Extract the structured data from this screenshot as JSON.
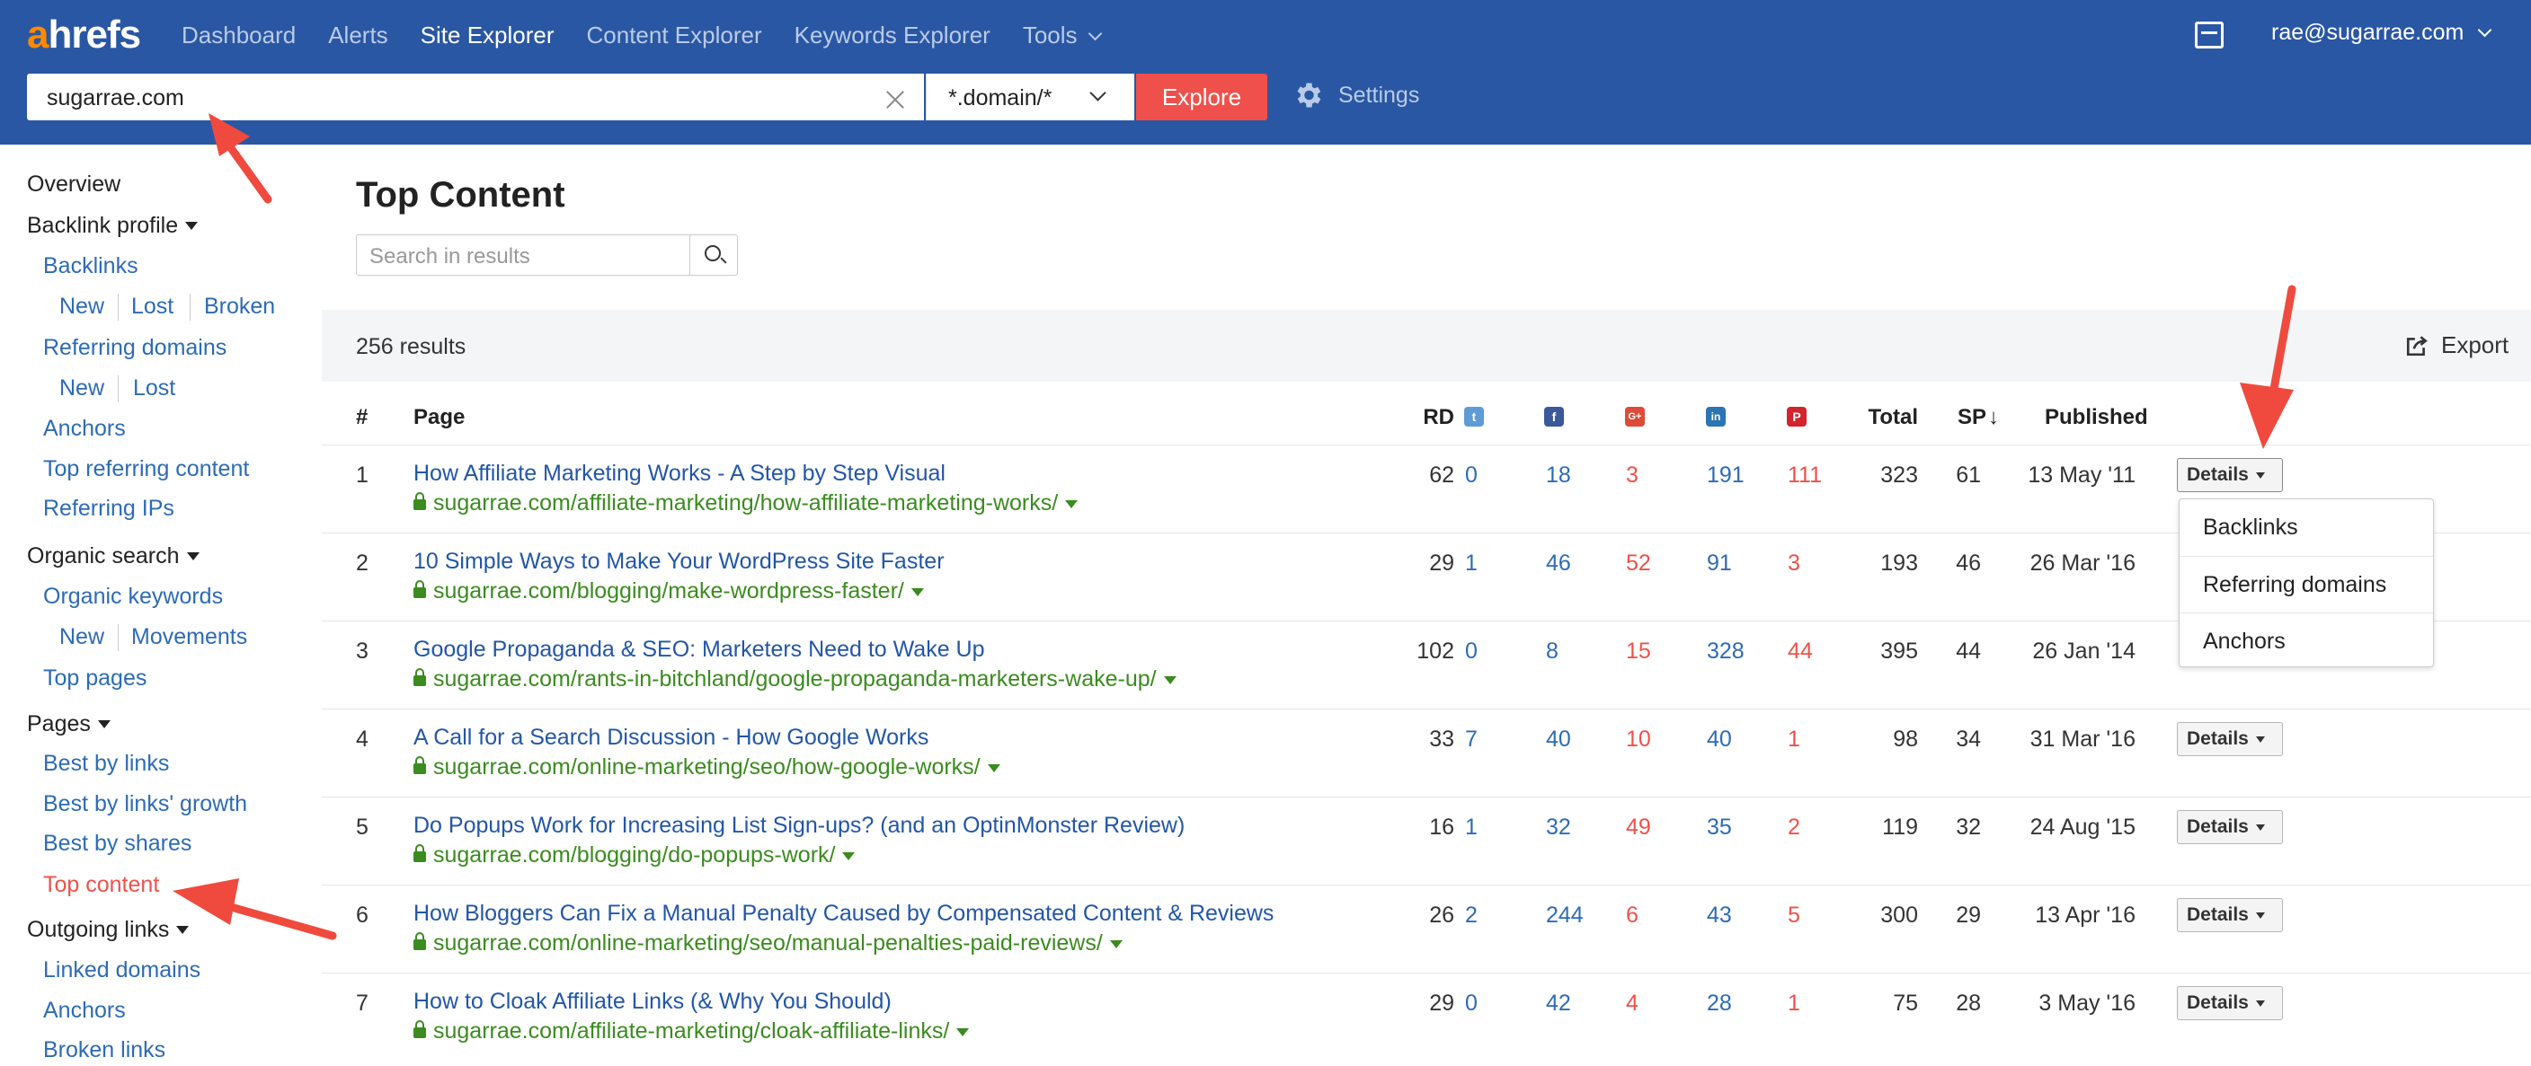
{
  "header": {
    "logo": "ahrefs",
    "nav": [
      "Dashboard",
      "Alerts",
      "Site Explorer",
      "Content Explorer",
      "Keywords Explorer",
      "Tools"
    ],
    "active_nav": "Site Explorer",
    "user_email": "rae@sugarrae.com",
    "search_value": "sugarrae.com",
    "mode": "*.domain/*",
    "explore_label": "Explore",
    "settings_label": "Settings"
  },
  "sidebar": {
    "overview": "Overview",
    "backlink_profile": "Backlink profile",
    "backlinks": "Backlinks",
    "new1": "New",
    "lost1": "Lost",
    "broken1": "Broken",
    "referring_domains": "Referring domains",
    "new2": "New",
    "lost2": "Lost",
    "anchors1": "Anchors",
    "top_referring_content": "Top referring content",
    "referring_ips": "Referring IPs",
    "organic_search": "Organic search",
    "organic_keywords": "Organic keywords",
    "new3": "New",
    "movements": "Movements",
    "top_pages": "Top pages",
    "pages": "Pages",
    "best_by_links": "Best by links",
    "best_by_links_growth": "Best by links' growth",
    "best_by_shares": "Best by shares",
    "top_content": "Top content",
    "outgoing_links": "Outgoing links",
    "linked_domains": "Linked domains",
    "anchors2": "Anchors",
    "broken_links": "Broken links"
  },
  "main": {
    "title": "Top Content",
    "search_placeholder": "Search in results",
    "results_count": "256 results",
    "export_label": "Export",
    "columns": {
      "num": "#",
      "page": "Page",
      "rd": "RD",
      "total": "Total",
      "sp": "SP",
      "published": "Published"
    },
    "details_label": "Details",
    "rows": [
      {
        "n": "1",
        "title": "How Affiliate Marketing Works - A Step by Step Visual",
        "url": "sugarrae.com/affiliate-marketing/how-affiliate-marketing-works/",
        "rd": "62",
        "tw": "0",
        "fb": "18",
        "gp": "3",
        "li": "191",
        "pi": "111",
        "total": "323",
        "sp": "61",
        "published": "13 May '11"
      },
      {
        "n": "2",
        "title": "10 Simple Ways to Make Your WordPress Site Faster",
        "url": "sugarrae.com/blogging/make-wordpress-faster/",
        "rd": "29",
        "tw": "1",
        "fb": "46",
        "gp": "52",
        "li": "91",
        "pi": "3",
        "total": "193",
        "sp": "46",
        "published": "26 Mar '16"
      },
      {
        "n": "3",
        "title": "Google Propaganda & SEO: Marketers Need to Wake Up",
        "url": "sugarrae.com/rants-in-bitchland/google-propaganda-marketers-wake-up/",
        "rd": "102",
        "tw": "0",
        "fb": "8",
        "gp": "15",
        "li": "328",
        "pi": "44",
        "total": "395",
        "sp": "44",
        "published": "26 Jan '14"
      },
      {
        "n": "4",
        "title": "A Call for a Search Discussion - How Google Works",
        "url": "sugarrae.com/online-marketing/seo/how-google-works/",
        "rd": "33",
        "tw": "7",
        "fb": "40",
        "gp": "10",
        "li": "40",
        "pi": "1",
        "total": "98",
        "sp": "34",
        "published": "31 Mar '16"
      },
      {
        "n": "5",
        "title": "Do Popups Work for Increasing List Sign-ups? (and an OptinMonster Review)",
        "url": "sugarrae.com/blogging/do-popups-work/",
        "rd": "16",
        "tw": "1",
        "fb": "32",
        "gp": "49",
        "li": "35",
        "pi": "2",
        "total": "119",
        "sp": "32",
        "published": "24 Aug '15"
      },
      {
        "n": "6",
        "title": "How Bloggers Can Fix a Manual Penalty Caused by Compensated Content & Reviews",
        "url": "sugarrae.com/online-marketing/seo/manual-penalties-paid-reviews/",
        "rd": "26",
        "tw": "2",
        "fb": "244",
        "gp": "6",
        "li": "43",
        "pi": "5",
        "total": "300",
        "sp": "29",
        "published": "13 Apr '16"
      },
      {
        "n": "7",
        "title": "How to Cloak Affiliate Links (& Why You Should)",
        "url": "sugarrae.com/affiliate-marketing/cloak-affiliate-links/",
        "rd": "29",
        "tw": "0",
        "fb": "42",
        "gp": "4",
        "li": "28",
        "pi": "1",
        "total": "75",
        "sp": "28",
        "published": "3 May '16"
      }
    ],
    "dropdown": [
      "Backlinks",
      "Referring domains",
      "Anchors"
    ]
  },
  "colors": {
    "header_bg": "#2a57a3",
    "accent_red": "#f0504b",
    "link_blue": "#2256a8",
    "url_green": "#3b8b1f"
  },
  "icons": [
    "inbox-icon",
    "gear-icon",
    "search-icon",
    "export-icon",
    "twitter-icon",
    "facebook-icon",
    "google-plus-icon",
    "linkedin-icon",
    "pinterest-icon",
    "lock-icon"
  ]
}
